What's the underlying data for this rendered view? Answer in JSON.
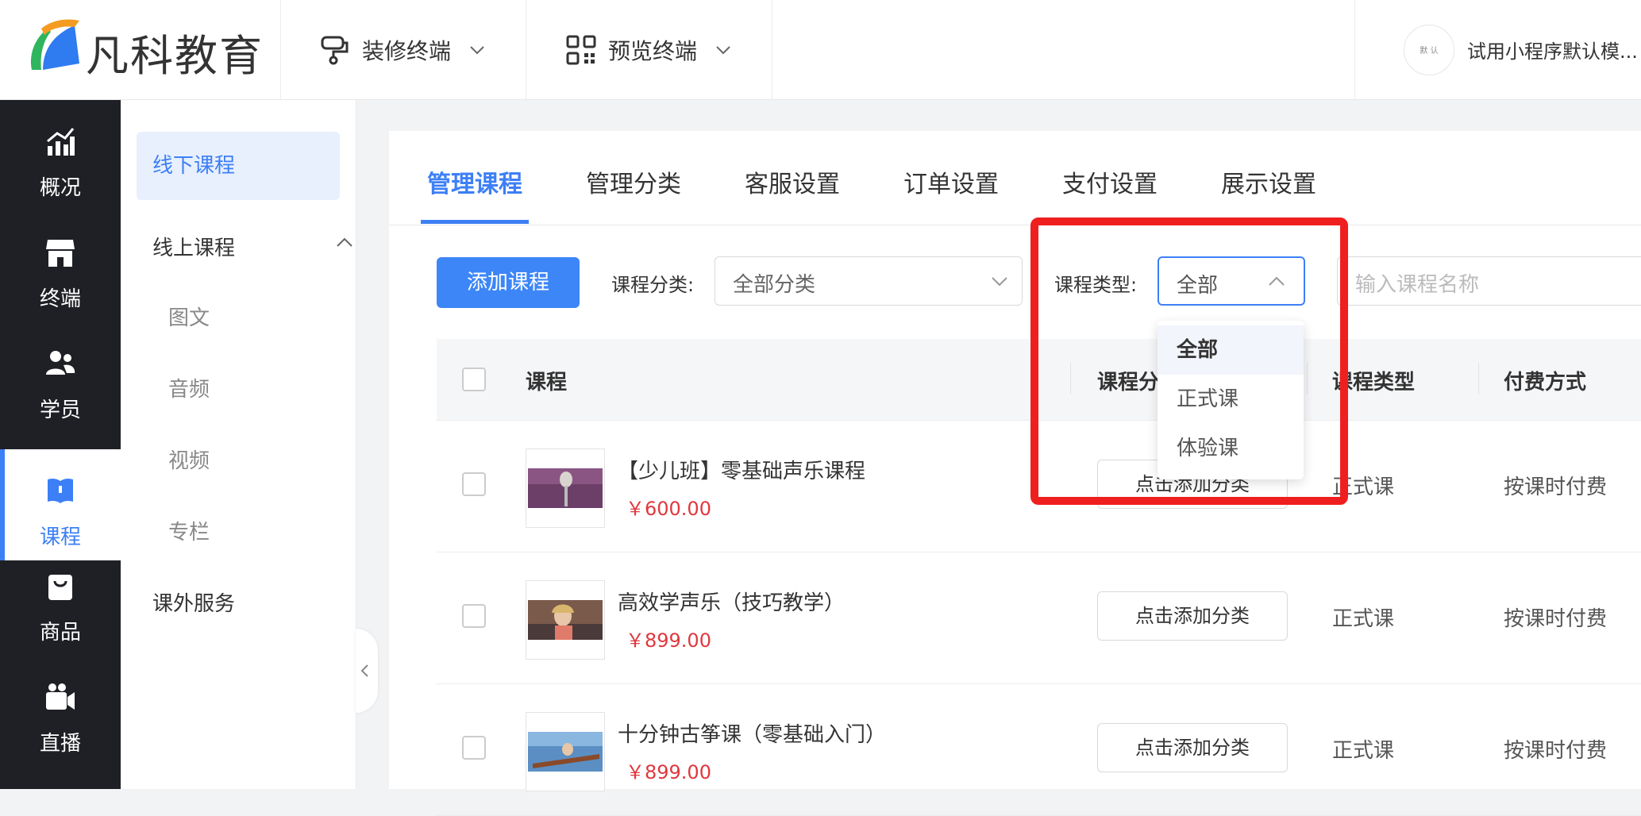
{
  "brand": {
    "name": "凡科教育"
  },
  "topbar": {
    "menus": [
      {
        "label": "装修终端",
        "icon": "paint-roller-icon"
      },
      {
        "label": "预览终端",
        "icon": "qr-code-icon"
      }
    ],
    "account": {
      "name": "试用小程序默认模...",
      "avatar_text": "默 认"
    }
  },
  "leftnav": [
    {
      "label": "概况",
      "icon": "chart-icon"
    },
    {
      "label": "终端",
      "icon": "store-icon"
    },
    {
      "label": "学员",
      "icon": "users-icon"
    },
    {
      "label": "课程",
      "icon": "book-icon",
      "active": true
    },
    {
      "label": "商品",
      "icon": "bag-icon"
    },
    {
      "label": "直播",
      "icon": "video-camera-icon"
    }
  ],
  "subnav": {
    "offline": "线下课程",
    "online": "线上课程",
    "children": [
      "图文",
      "音频",
      "视频",
      "专栏"
    ],
    "extra": "课外服务"
  },
  "tabs": [
    "管理课程",
    "管理分类",
    "客服设置",
    "订单设置",
    "支付设置",
    "展示设置"
  ],
  "toolbar": {
    "add_button": "添加课程",
    "category_label": "课程分类:",
    "category_value": "全部分类",
    "type_label": "课程类型:",
    "type_value": "全部",
    "search_placeholder": "输入课程名称"
  },
  "table": {
    "headers": [
      "课程",
      "课程分类",
      "课程类型",
      "付费方式"
    ],
    "rows": [
      {
        "name": "【少儿班】零基础声乐课程",
        "price": "￥600.00",
        "category": "点击添加分类",
        "type": "正式课",
        "pay": "按课时付费"
      },
      {
        "name": "高效学声乐（技巧教学）",
        "price": "￥899.00",
        "category": "点击添加分类",
        "type": "正式课",
        "pay": "按课时付费"
      },
      {
        "name": "十分钟古筝课（零基础入门）",
        "price": "￥899.00",
        "category": "点击添加分类",
        "type": "正式课",
        "pay": "按课时付费"
      }
    ]
  },
  "dropdown": {
    "options": [
      "全部",
      "正式课",
      "体验课"
    ],
    "selected": "全部"
  },
  "colors": {
    "accent": "#3d7ff6",
    "price": "#e0383e",
    "highlight": "#f01f1f",
    "nav_bg": "#1f2025"
  }
}
